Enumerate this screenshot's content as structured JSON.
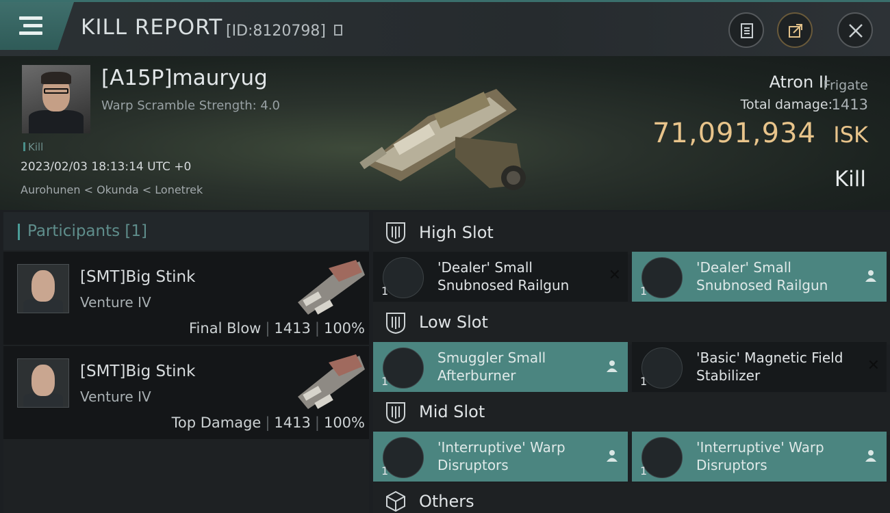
{
  "header": {
    "title": "KILL REPORT",
    "report_id": "[ID:8120798]",
    "buttons": [
      "clipboard-icon",
      "share-icon",
      "close-icon"
    ]
  },
  "victim": {
    "name": "[A15P]mauryug",
    "warp_scramble": "Warp Scramble Strength: 4.0",
    "tag": "Kill",
    "datetime": "2023/02/03 18:13:14 UTC +0",
    "location": "Aurohunen < Okunda < Lonetrek",
    "ship_name": "Atron II",
    "ship_class": "Frigate",
    "total_damage_label": "Total damage:",
    "total_damage": "1413",
    "isk_value": "71,091,934",
    "isk_unit": "ISK",
    "result": "Kill"
  },
  "participants": {
    "title": "Participants [1]",
    "rows": [
      {
        "name": "[SMT]Big Stink",
        "ship": "Venture IV",
        "role": "Final Blow",
        "damage": "1413",
        "percent": "100%"
      },
      {
        "name": "[SMT]Big Stink",
        "ship": "Venture IV",
        "role": "Top Damage",
        "damage": "1413",
        "percent": "100%"
      }
    ]
  },
  "slots": {
    "high": {
      "title": "High Slot",
      "modules": [
        {
          "qty": "1",
          "name": "'Dealer' Small Snubnosed Railgun",
          "state": "destroyed"
        },
        {
          "qty": "1",
          "name": "'Dealer' Small Snubnosed Railgun",
          "state": "dropped"
        }
      ]
    },
    "low": {
      "title": "Low Slot",
      "modules": [
        {
          "qty": "1",
          "name": "Smuggler Small Afterburner",
          "state": "dropped"
        },
        {
          "qty": "1",
          "name": "'Basic' Magnetic Field Stabilizer",
          "state": "destroyed"
        }
      ]
    },
    "mid": {
      "title": "Mid Slot",
      "modules": [
        {
          "qty": "1",
          "name": "'Interruptive' Warp Disruptors",
          "state": "dropped"
        },
        {
          "qty": "1",
          "name": "'Interruptive' Warp Disruptors",
          "state": "dropped"
        }
      ]
    },
    "others": {
      "title": "Others"
    }
  },
  "colors": {
    "accent": "#4b8580",
    "isk": "#e8c48b",
    "destroyed_cell": "#16191b"
  }
}
